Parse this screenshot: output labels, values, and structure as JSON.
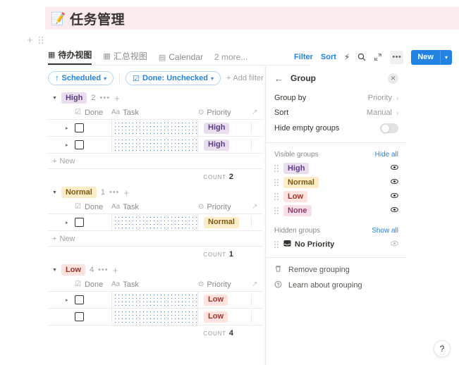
{
  "page": {
    "title_emoji": "📝",
    "title": "任务管理"
  },
  "add_row": {
    "plus_icon": "+",
    "grip_icon": "drag-handle"
  },
  "tabs": {
    "items": [
      {
        "label": "待办视图",
        "icon": "table-icon",
        "active": true
      },
      {
        "label": "汇总视图",
        "icon": "table-icon",
        "active": false
      },
      {
        "label": "Calendar",
        "icon": "calendar-icon",
        "active": false
      }
    ],
    "more_label": "2 more..."
  },
  "filter_bar": {
    "chips": [
      {
        "icon": "↑",
        "label": "Scheduled",
        "caret": "▾"
      },
      {
        "icon": "☑",
        "label": "Done: Unchecked",
        "caret": "▾"
      }
    ],
    "add_filter_label": "Add filter",
    "add_filter_icon": "+"
  },
  "toolbar": {
    "filter_label": "Filter",
    "sort_label": "Sort",
    "automation_icon": "⚡",
    "search_icon": "search-icon",
    "expand_icon": "expand-icon",
    "more_icon": "•••",
    "new_label": "New",
    "new_caret": "▾"
  },
  "table": {
    "columns": {
      "done": {
        "label": "Done",
        "icon": "checkbox-icon"
      },
      "task": {
        "label": "Task",
        "icon": "Aa"
      },
      "priority": {
        "label": "Priority",
        "icon": "select-icon"
      },
      "extra": {
        "icon": "↗"
      }
    },
    "new_row_label": "New",
    "new_row_icon": "+",
    "count_label": "COUNT",
    "groups": [
      {
        "name": "High",
        "color_class": "high",
        "count": "2",
        "count_value": "2",
        "dots": "•••",
        "plus": "+",
        "rows": [
          {
            "caret": "▸",
            "has_caret": true,
            "priority": "High",
            "priority_class": "high",
            "task_redacted": true
          },
          {
            "caret": "▸",
            "has_caret": true,
            "priority": "High",
            "priority_class": "high",
            "task_redacted": true
          }
        ]
      },
      {
        "name": "Normal",
        "color_class": "normal",
        "count": "1",
        "count_value": "1",
        "dots": "•••",
        "plus": "+",
        "rows": [
          {
            "caret": "▸",
            "has_caret": true,
            "priority": "Normal",
            "priority_class": "normal",
            "task_redacted": true
          }
        ]
      },
      {
        "name": "Low",
        "color_class": "low",
        "count": "4",
        "count_value": "4",
        "dots": "•••",
        "plus": "+",
        "rows": [
          {
            "caret": "▸",
            "has_caret": true,
            "priority": "Low",
            "priority_class": "low",
            "task_redacted": true
          },
          {
            "caret": "",
            "has_caret": false,
            "priority": "Low",
            "priority_class": "low",
            "task_redacted": true
          }
        ]
      }
    ]
  },
  "panel": {
    "back_icon": "←",
    "title": "Group",
    "close_icon": "✕",
    "group_by": {
      "label": "Group by",
      "value": "Priority",
      "chevron": "›"
    },
    "sort": {
      "label": "Sort",
      "value": "Manual",
      "chevron": "›"
    },
    "hide_empty": {
      "label": "Hide empty groups",
      "toggle_on": false
    },
    "visible_groups": {
      "section_label": "Visible groups",
      "action_label": "Hide all",
      "items": [
        {
          "name": "High",
          "color_class": "high",
          "eye_icon": "eye-icon"
        },
        {
          "name": "Normal",
          "color_class": "normal",
          "eye_icon": "eye-icon"
        },
        {
          "name": "Low",
          "color_class": "low",
          "eye_icon": "eye-icon"
        },
        {
          "name": "None",
          "color_class": "none",
          "eye_icon": "eye-icon"
        }
      ]
    },
    "hidden_groups": {
      "section_label": "Hidden groups",
      "action_label": "Show all",
      "items": [
        {
          "name": "No Priority",
          "icon": "inbox-icon",
          "eye_icon": "eye-off-icon"
        }
      ]
    },
    "actions": [
      {
        "label": "Remove grouping",
        "icon": "trash-icon"
      },
      {
        "label": "Learn about grouping",
        "icon": "question-icon"
      }
    ]
  },
  "help_button": {
    "label": "?"
  },
  "colors": {
    "accent_blue": "#2383e2",
    "title_banner": "#fcebec",
    "high_bg": "#e8deee",
    "normal_bg": "#fdecc8",
    "low_bg": "#ffe2dd",
    "none_bg": "#f7dfe9"
  }
}
